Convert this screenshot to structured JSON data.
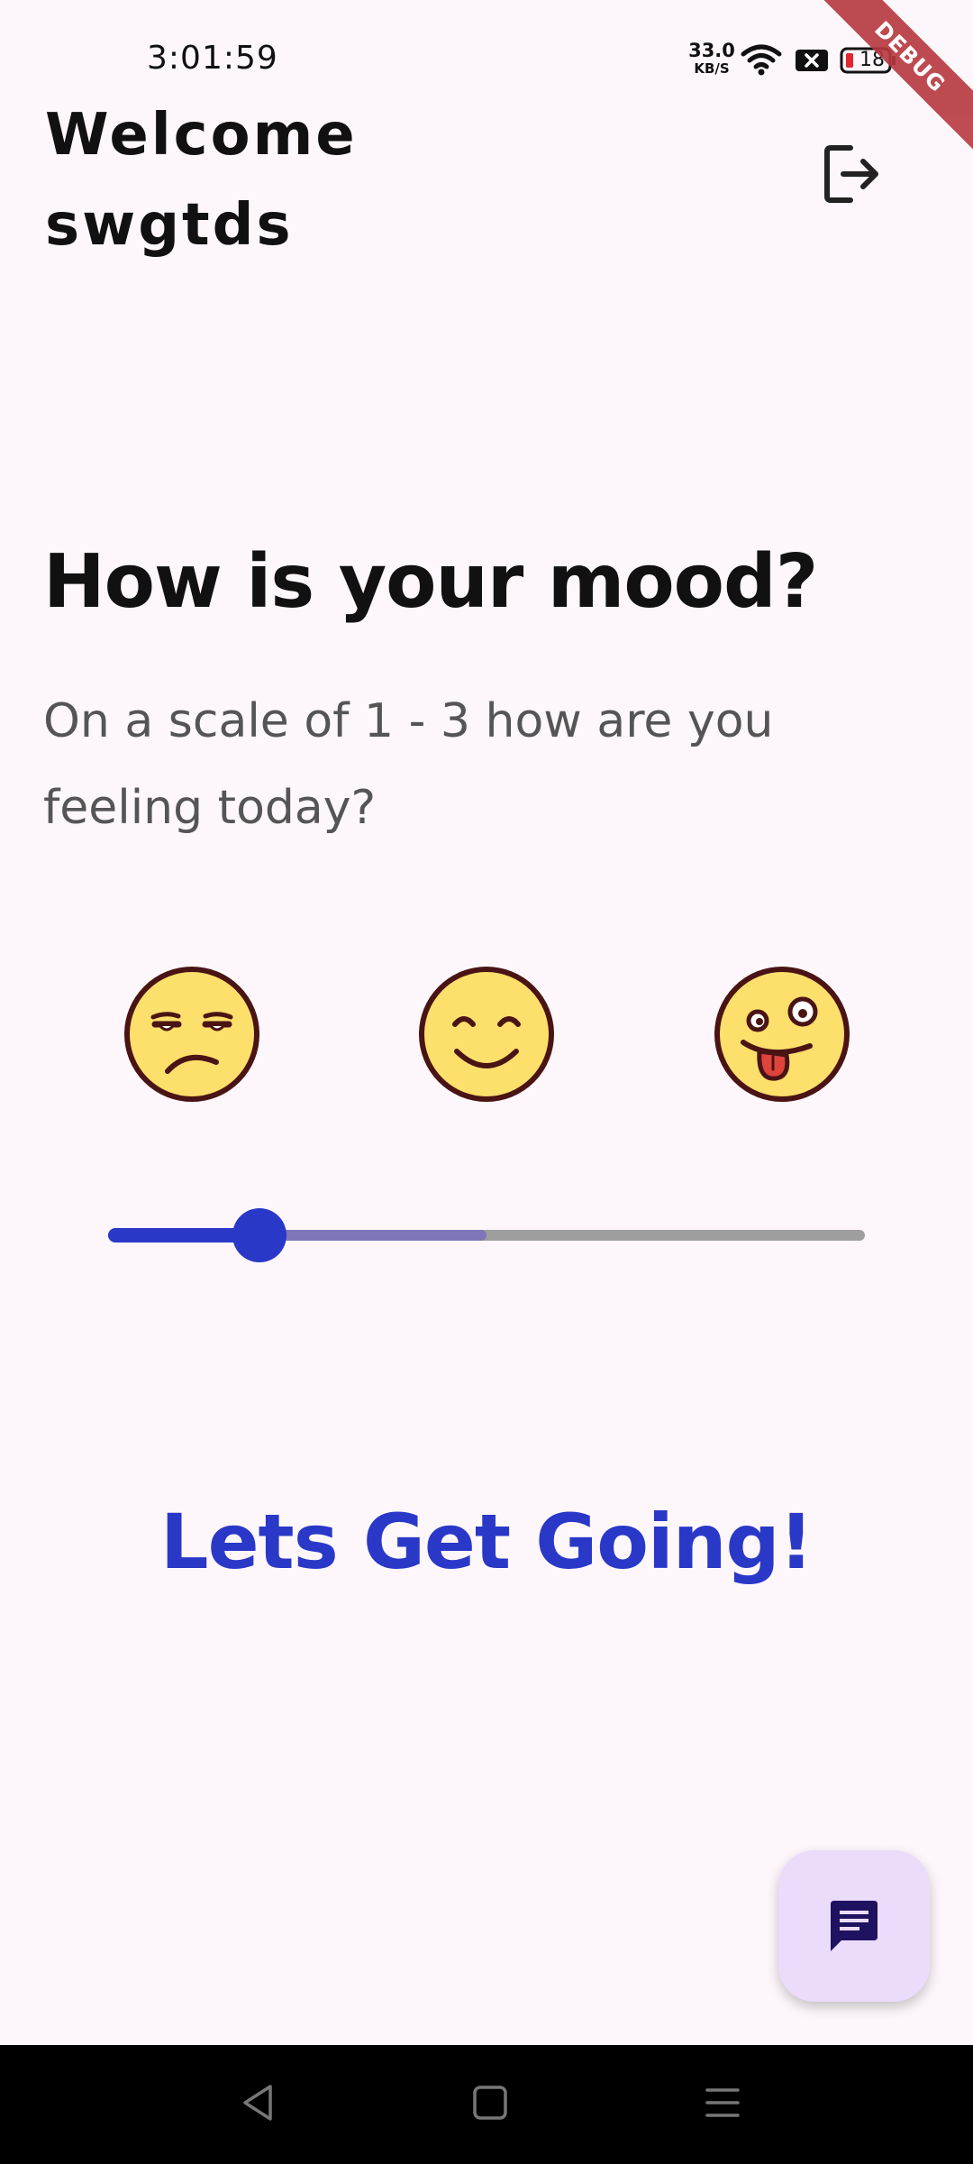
{
  "status_bar": {
    "time": "3:01:59",
    "net_speed_value": "33.0",
    "net_speed_unit": "KB/S",
    "battery": "18"
  },
  "debug_banner": "DEBUG",
  "header": {
    "welcome_label": "Welcome",
    "username": "swgtds"
  },
  "mood": {
    "title": "How is your mood?",
    "subtitle": "On a scale of 1 - 3 how are you feeling today?",
    "emojis": [
      "unamused-face-icon",
      "smiling-face-icon",
      "zany-tongue-face-icon"
    ],
    "slider": {
      "min": 1,
      "max": 3,
      "value": 1.4,
      "secondary_value": 2.0
    }
  },
  "cta_label": "Lets Get Going!",
  "fab_icon": "chat-icon",
  "colors": {
    "accent": "#2a38c8",
    "background": "#fdf7fb",
    "fab_background": "#ebdcfc",
    "fab_icon": "#1f1260",
    "emoji_fill": "#fddf6c"
  }
}
